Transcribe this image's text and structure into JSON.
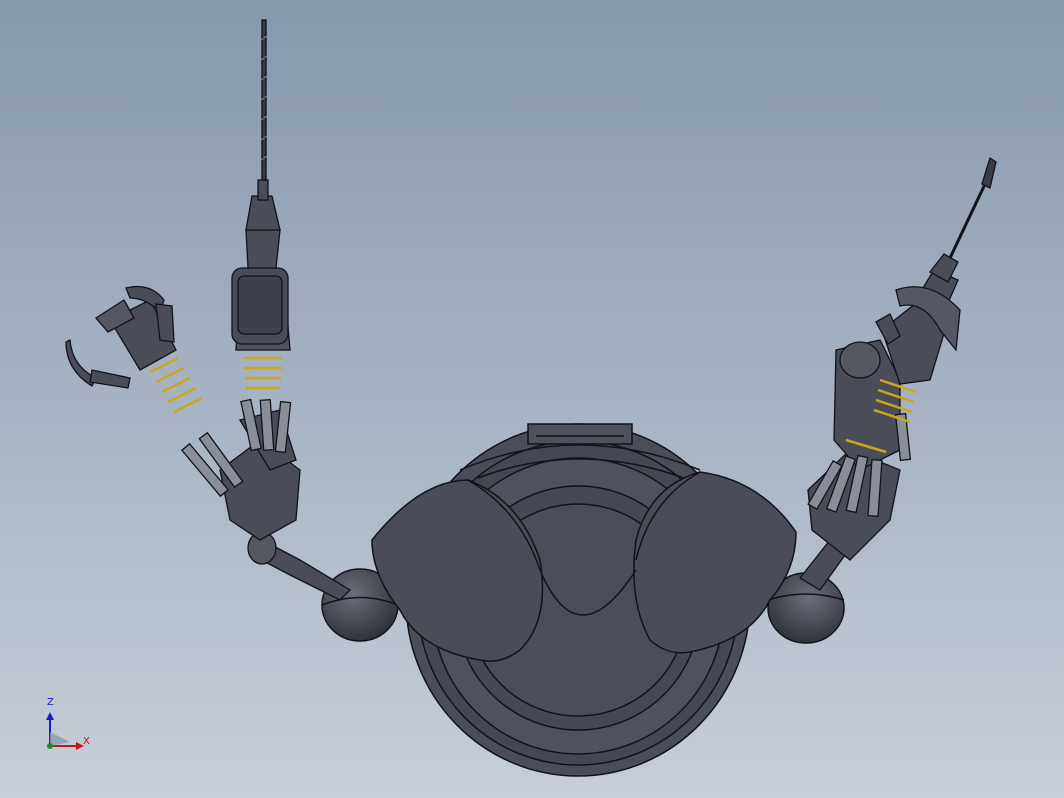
{
  "viewport": {
    "background_top": "#8798ad",
    "background_bottom": "#c7ced8",
    "model_color": "#4a4d57",
    "edge_color": "#121318",
    "accent_spring_color": "#c8a81c"
  },
  "triad": {
    "z_label": "Z",
    "x_label": "X",
    "z_color": "#1a1ad0",
    "x_color": "#c01818"
  }
}
